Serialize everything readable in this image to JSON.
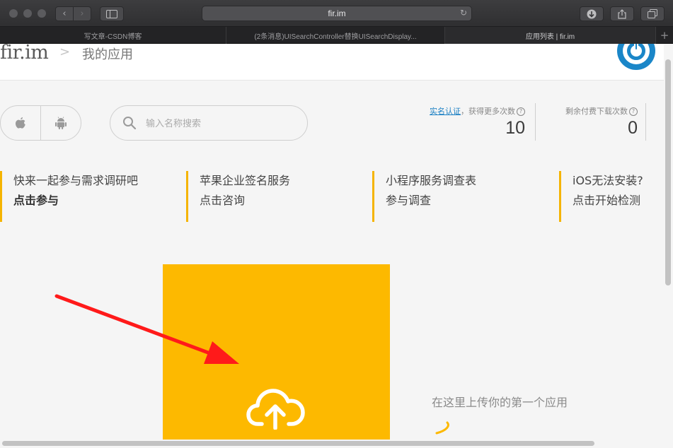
{
  "browser": {
    "url": "fir.im",
    "tabs": [
      {
        "title": "写文章-CSDN博客"
      },
      {
        "title": "(2条消息)UISearchController替换UISearchDisplay..."
      },
      {
        "title": "应用列表 | fir.im"
      }
    ],
    "new_tab_label": "+"
  },
  "header": {
    "logo": "fir.im",
    "separator": ">",
    "breadcrumb": "我的应用"
  },
  "toolbar": {
    "search_placeholder": "输入名称搜索"
  },
  "stats": {
    "verify_link": "实名认证",
    "verify_suffix": "，获得更多次数",
    "downloads_value": "10",
    "paid_label": "剩余付费下载次数",
    "paid_value": "0"
  },
  "banners": [
    {
      "line1": "快来一起参与需求调研吧",
      "line2": "点击参与"
    },
    {
      "line1": "苹果企业签名服务",
      "line2": "点击咨询"
    },
    {
      "line1": "小程序服务调查表",
      "line2": "参与调查"
    },
    {
      "line1": "iOS无法安装?",
      "line2": "点击开始检测"
    }
  ],
  "upload": {
    "hint": "在这里上传你的第一个应用"
  },
  "colors": {
    "accent": "#fdb900",
    "link": "#1a7fc3",
    "avatar": "#1a86c8",
    "annotation_arrow": "#ff1a1a"
  },
  "icons": {
    "apple": "apple-icon",
    "android": "android-icon",
    "search": "search-icon",
    "upload": "cloud-upload-icon"
  }
}
